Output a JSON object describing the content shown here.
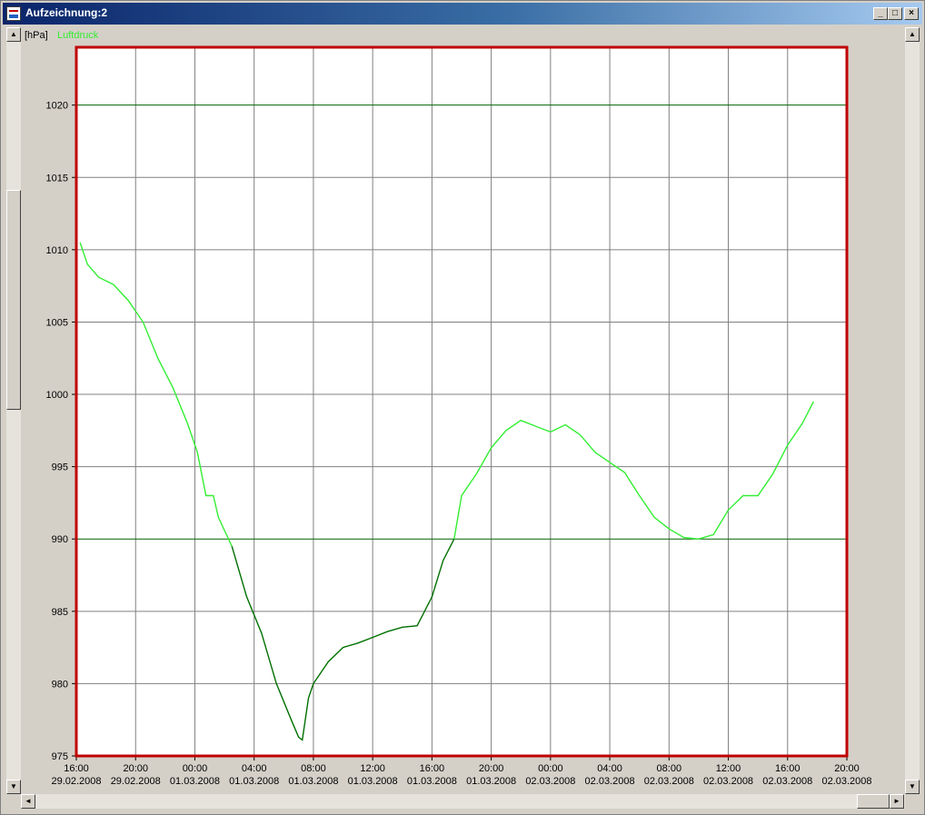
{
  "window": {
    "title": "Aufzeichnung:2"
  },
  "title_buttons": {
    "minimize": "_",
    "maximize": "□",
    "close": "×"
  },
  "scroll": {
    "up": "▲",
    "down": "▼",
    "left": "◄",
    "right": "►"
  },
  "legend": {
    "unit": "[hPa]",
    "series": "Luftdruck"
  },
  "colors": {
    "plot_border": "#c00000",
    "series": "#33ee33",
    "series_dark": "#007000",
    "gridline": "#808080",
    "highlight_grid": "#006400"
  },
  "chart_data": {
    "type": "line",
    "ylim": [
      975,
      1024
    ],
    "yticks": [
      975,
      980,
      985,
      990,
      995,
      1000,
      1005,
      1010,
      1015,
      1020
    ],
    "highlight_y": [
      990,
      1020
    ],
    "xlim": [
      "2008-02-29T16:00",
      "2008-03-02T20:00"
    ],
    "xticks": [
      {
        "time": "16:00",
        "date": "29.02.2008"
      },
      {
        "time": "20:00",
        "date": "29.02.2008"
      },
      {
        "time": "00:00",
        "date": "01.03.2008"
      },
      {
        "time": "04:00",
        "date": "01.03.2008"
      },
      {
        "time": "08:00",
        "date": "01.03.2008"
      },
      {
        "time": "12:00",
        "date": "01.03.2008"
      },
      {
        "time": "16:00",
        "date": "01.03.2008"
      },
      {
        "time": "20:00",
        "date": "01.03.2008"
      },
      {
        "time": "00:00",
        "date": "02.03.2008"
      },
      {
        "time": "04:00",
        "date": "02.03.2008"
      },
      {
        "time": "08:00",
        "date": "02.03.2008"
      },
      {
        "time": "12:00",
        "date": "02.03.2008"
      },
      {
        "time": "16:00",
        "date": "02.03.2008"
      },
      {
        "time": "20:00",
        "date": "02.03.2008"
      }
    ],
    "series": [
      {
        "name": "Luftdruck",
        "x": [
          "2008-02-29T16:15",
          "2008-02-29T16:45",
          "2008-02-29T17:30",
          "2008-02-29T18:30",
          "2008-02-29T19:30",
          "2008-02-29T20:30",
          "2008-02-29T21:30",
          "2008-02-29T22:30",
          "2008-02-29T23:30",
          "2008-03-01T00:10",
          "2008-03-01T00:45",
          "2008-03-01T01:15",
          "2008-03-01T01:35",
          "2008-03-01T02:30",
          "2008-03-01T03:30",
          "2008-03-01T04:30",
          "2008-03-01T05:30",
          "2008-03-01T06:30",
          "2008-03-01T07:00",
          "2008-03-01T07:15",
          "2008-03-01T07:40",
          "2008-03-01T08:00",
          "2008-03-01T09:00",
          "2008-03-01T10:00",
          "2008-03-01T11:00",
          "2008-03-01T12:00",
          "2008-03-01T13:00",
          "2008-03-01T14:00",
          "2008-03-01T15:00",
          "2008-03-01T16:00",
          "2008-03-01T16:45",
          "2008-03-01T17:30",
          "2008-03-01T18:00",
          "2008-03-01T19:00",
          "2008-03-01T20:00",
          "2008-03-01T21:00",
          "2008-03-01T22:00",
          "2008-03-01T23:00",
          "2008-03-02T00:00",
          "2008-03-02T01:00",
          "2008-03-02T02:00",
          "2008-03-02T03:00",
          "2008-03-02T04:00",
          "2008-03-02T05:00",
          "2008-03-02T06:00",
          "2008-03-02T07:00",
          "2008-03-02T08:00",
          "2008-03-02T09:00",
          "2008-03-02T10:00",
          "2008-03-02T11:00",
          "2008-03-02T12:00",
          "2008-03-02T13:00",
          "2008-03-02T14:00",
          "2008-03-02T15:00",
          "2008-03-02T16:00",
          "2008-03-02T17:00",
          "2008-03-02T17:45"
        ],
        "y": [
          1010.5,
          1009.0,
          1008.1,
          1007.6,
          1006.5,
          1005.0,
          1002.5,
          1000.5,
          998.0,
          996.0,
          993.0,
          993.0,
          991.5,
          989.5,
          986.0,
          983.5,
          980.0,
          977.5,
          976.3,
          976.1,
          979.0,
          980.0,
          981.5,
          982.5,
          982.8,
          983.2,
          983.6,
          983.9,
          984.0,
          986.0,
          988.5,
          990.0,
          993.0,
          994.5,
          996.3,
          997.5,
          998.2,
          997.8,
          997.4,
          997.9,
          997.2,
          996.0,
          995.3,
          994.6,
          993.0,
          991.5,
          990.7,
          990.1,
          990.0,
          990.3,
          992.0,
          993.0,
          993.0,
          994.5,
          996.5,
          998.0,
          999.5
        ]
      }
    ]
  }
}
